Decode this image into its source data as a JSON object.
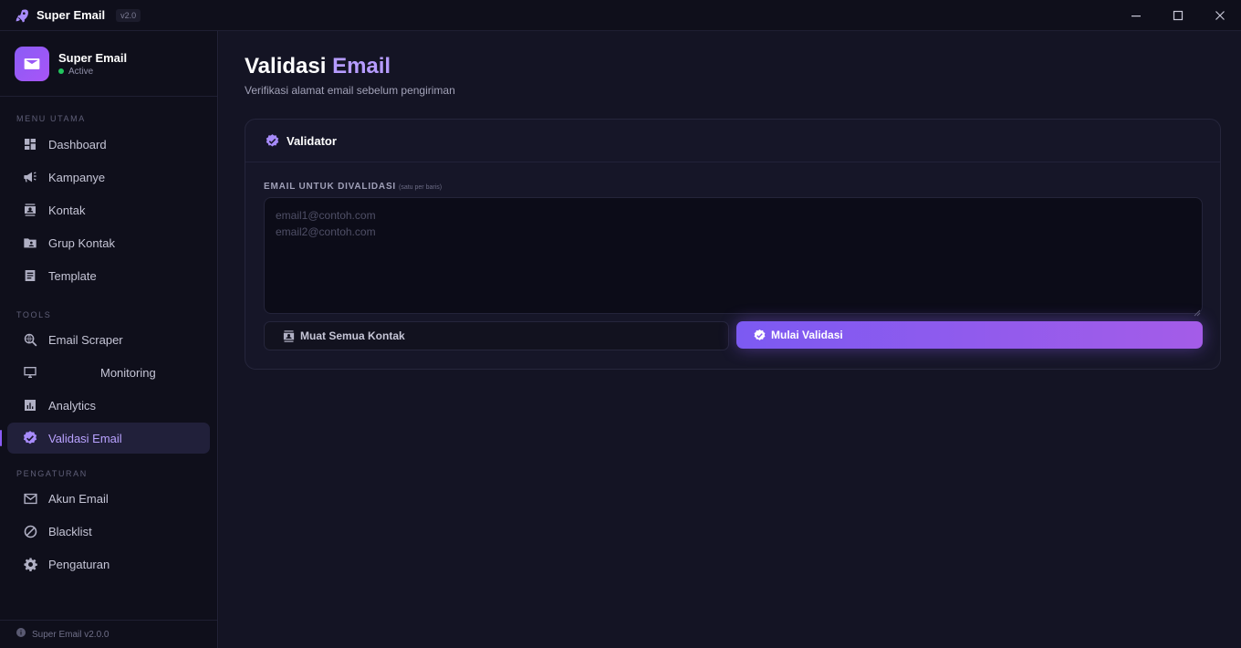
{
  "window": {
    "title": "Super Email",
    "version": "v2.0"
  },
  "profile": {
    "name": "Super Email",
    "status": "Active"
  },
  "sidebar": {
    "sections": [
      {
        "label": "MENU UTAMA"
      },
      {
        "label": "TOOLS"
      },
      {
        "label": "PENGATURAN"
      }
    ],
    "items": [
      {
        "label": "Dashboard",
        "icon": "dashboard-icon"
      },
      {
        "label": "Kampanye",
        "icon": "megaphone-icon"
      },
      {
        "label": "Kontak",
        "icon": "contact-icon"
      },
      {
        "label": "Grup Kontak",
        "icon": "folder-user-icon"
      },
      {
        "label": "Template",
        "icon": "document-icon"
      },
      {
        "label": "Email Scraper",
        "icon": "search-globe-icon"
      },
      {
        "label": "Monitoring",
        "icon": "monitor-icon"
      },
      {
        "label": "Analytics",
        "icon": "analytics-icon"
      },
      {
        "label": "Validasi Email",
        "icon": "verified-icon",
        "active": true
      },
      {
        "label": "Akun Email",
        "icon": "mail-icon"
      },
      {
        "label": "Blacklist",
        "icon": "block-icon"
      },
      {
        "label": "Pengaturan",
        "icon": "gear-icon"
      }
    ],
    "footer": "Super Email v2.0.0"
  },
  "page": {
    "title_prefix": "Validasi",
    "title_accent": "Email",
    "subtitle": "Verifikasi alamat email sebelum pengiriman"
  },
  "validator": {
    "title": "Validator",
    "field_label": "EMAIL UNTUK DIVALIDASI",
    "field_hint": "(satu per baris)",
    "placeholder": "email1@contoh.com\nemail2@contoh.com",
    "value": "",
    "load_button": "Muat Semua Kontak",
    "validate_button": "Mulai Validasi"
  },
  "colors": {
    "accent": "#8b5cf6",
    "accent_text": "#b69cff",
    "status_active": "#22c55e",
    "background": "#141424",
    "sidebar": "#0f0f1b"
  }
}
